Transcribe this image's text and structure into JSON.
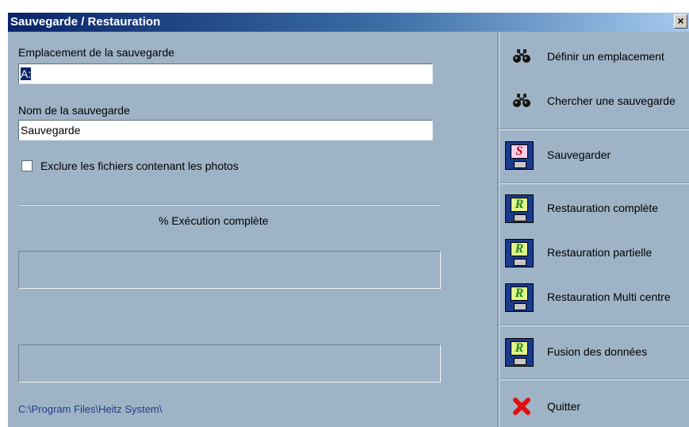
{
  "window": {
    "title": "Sauvegarde / Restauration",
    "close_label": "×"
  },
  "location": {
    "label": "Emplacement de la sauvegarde",
    "value": "A:"
  },
  "name": {
    "label": "Nom de la sauvegarde",
    "value": "Sauvegarde"
  },
  "exclude_photos": {
    "label": "Exclure les fichiers contenant les photos",
    "checked": false
  },
  "progress": {
    "label": "% Exécution complète"
  },
  "footer": {
    "path": "C:\\Program Files\\Heitz System\\"
  },
  "actions": {
    "define_location": "Définir un emplacement",
    "find_backup": "Chercher une sauvegarde",
    "save": "Sauvegarder",
    "save_disk_letter": "S",
    "restore_letter": "R",
    "restore_full": "Restauration complète",
    "restore_partial": "Restauration partielle",
    "restore_multi": "Restauration Multi centre",
    "merge": "Fusion des données",
    "quit": "Quitter"
  },
  "colors": {
    "panel": "#9eb4c6",
    "titlebar": "#0a246a",
    "quit_icon": "#e01010"
  },
  "icons": [
    "binoculars-icon",
    "save-disk-icon",
    "restore-disk-icon",
    "quit-x-icon"
  ]
}
